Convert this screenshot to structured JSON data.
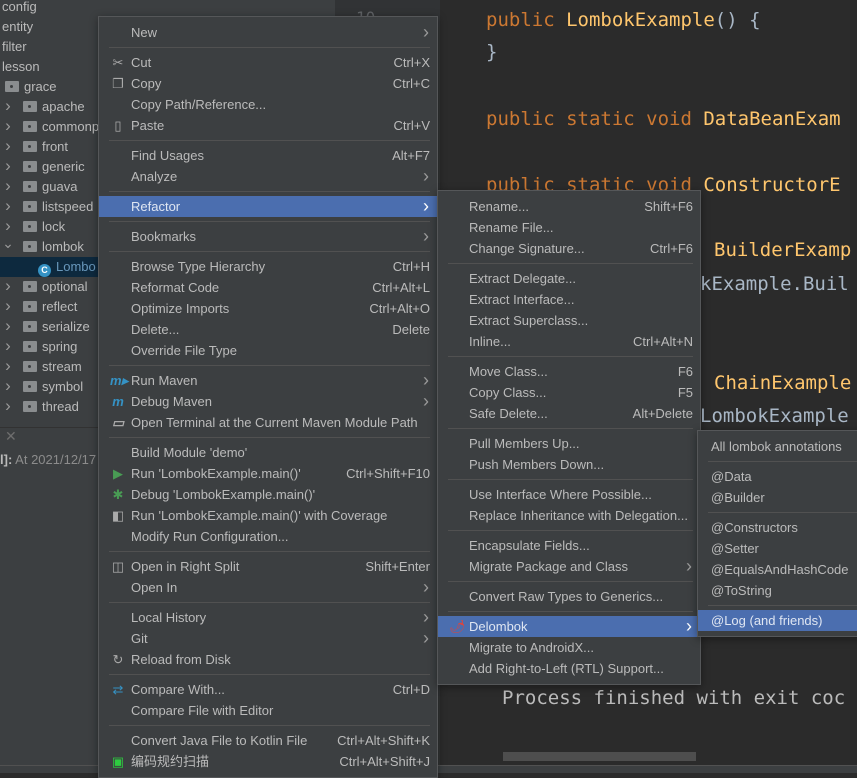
{
  "tree": {
    "items": [
      {
        "label": "config",
        "level": 0,
        "kind": "pkg"
      },
      {
        "label": "entity",
        "level": 0,
        "kind": "pkg"
      },
      {
        "label": "filter",
        "level": 0,
        "kind": "pkg"
      },
      {
        "label": "lesson",
        "level": 0,
        "kind": "pkg"
      },
      {
        "label": "grace",
        "level": 1,
        "kind": "folder"
      },
      {
        "label": "apache",
        "level": 2,
        "kind": "folder",
        "chevron": "right"
      },
      {
        "label": "commonp",
        "level": 2,
        "kind": "folder",
        "chevron": "right"
      },
      {
        "label": "front",
        "level": 2,
        "kind": "folder",
        "chevron": "right"
      },
      {
        "label": "generic",
        "level": 2,
        "kind": "folder",
        "chevron": "right"
      },
      {
        "label": "guava",
        "level": 2,
        "kind": "folder",
        "chevron": "right"
      },
      {
        "label": "listspeed",
        "level": 2,
        "kind": "folder",
        "chevron": "right"
      },
      {
        "label": "lock",
        "level": 2,
        "kind": "folder",
        "chevron": "right"
      },
      {
        "label": "lombok",
        "level": 2,
        "kind": "folder",
        "chevron": "down"
      },
      {
        "label": "Lombo",
        "level": 3,
        "kind": "class",
        "selected": true
      },
      {
        "label": "optional",
        "level": 2,
        "kind": "folder",
        "chevron": "right"
      },
      {
        "label": "reflect",
        "level": 2,
        "kind": "folder",
        "chevron": "right"
      },
      {
        "label": "serialize",
        "level": 2,
        "kind": "folder",
        "chevron": "right"
      },
      {
        "label": "spring",
        "level": 2,
        "kind": "folder",
        "chevron": "right"
      },
      {
        "label": "stream",
        "level": 2,
        "kind": "folder",
        "chevron": "right"
      },
      {
        "label": "symbol",
        "level": 2,
        "kind": "folder",
        "chevron": "right"
      },
      {
        "label": "thread",
        "level": 2,
        "kind": "folder",
        "chevron": "right"
      }
    ]
  },
  "log": {
    "prefix": "l]:",
    "text": " At 2021/12/17"
  },
  "editor": {
    "line_number": "10",
    "lines": [
      {
        "kw": "public ",
        "fn": "LombokExample",
        "rest": "() {"
      },
      {
        "kw": "",
        "fn": "",
        "rest": "}"
      },
      {
        "kw": "public static void ",
        "fn": "DataBeanExam",
        "rest": ""
      },
      {
        "kw": "public static void ",
        "fn": "ConstructorE",
        "rest": ""
      },
      {
        "kw": "",
        "fn": "BuilderExamp",
        "rest": ""
      },
      {
        "kw": "",
        "fn": "",
        "rest": "kExample.Buil"
      },
      {
        "kw": "",
        "fn": "ChainExample",
        "rest": ""
      },
      {
        "kw": "",
        "fn": "",
        "rest": "LombokExample"
      }
    ]
  },
  "console": {
    "text": "Process finished with exit coc"
  },
  "colors": {
    "menu_bg": "#3c3f41",
    "highlight": "#4b6eaf",
    "keyword": "#cc7832",
    "method": "#ffc66d",
    "text": "#a9b7c6"
  },
  "main_menu": [
    {
      "label": "New",
      "submenu": true
    },
    {
      "sep": true
    },
    {
      "label": "Cut",
      "shortcut": "Ctrl+X",
      "icon": "scissors-icon"
    },
    {
      "label": "Copy",
      "shortcut": "Ctrl+C",
      "icon": "copy-icon"
    },
    {
      "label": "Copy Path/Reference..."
    },
    {
      "label": "Paste",
      "shortcut": "Ctrl+V",
      "icon": "paste-icon"
    },
    {
      "sep": true
    },
    {
      "label": "Find Usages",
      "shortcut": "Alt+F7"
    },
    {
      "label": "Analyze",
      "submenu": true
    },
    {
      "sep": true
    },
    {
      "label": "Refactor",
      "submenu": true,
      "highlighted": true
    },
    {
      "sep": true
    },
    {
      "label": "Bookmarks",
      "submenu": true
    },
    {
      "sep": true
    },
    {
      "label": "Browse Type Hierarchy",
      "shortcut": "Ctrl+H"
    },
    {
      "label": "Reformat Code",
      "shortcut": "Ctrl+Alt+L"
    },
    {
      "label": "Optimize Imports",
      "shortcut": "Ctrl+Alt+O"
    },
    {
      "label": "Delete...",
      "shortcut": "Delete"
    },
    {
      "label": "Override File Type"
    },
    {
      "sep": true
    },
    {
      "label": "Run Maven",
      "submenu": true,
      "icon": "maven-run-icon"
    },
    {
      "label": "Debug Maven",
      "submenu": true,
      "icon": "maven-debug-icon"
    },
    {
      "label": "Open Terminal at the Current Maven Module Path",
      "icon": "maven-terminal-icon"
    },
    {
      "sep": true
    },
    {
      "label": "Build Module 'demo'"
    },
    {
      "label": "Run 'LombokExample.main()'",
      "shortcut": "Ctrl+Shift+F10",
      "icon": "run-icon"
    },
    {
      "label": "Debug 'LombokExample.main()'",
      "icon": "debug-icon"
    },
    {
      "label": "Run 'LombokExample.main()' with Coverage",
      "icon": "coverage-icon"
    },
    {
      "label": "Modify Run Configuration..."
    },
    {
      "sep": true
    },
    {
      "label": "Open in Right Split",
      "shortcut": "Shift+Enter",
      "icon": "split-icon"
    },
    {
      "label": "Open In",
      "submenu": true
    },
    {
      "sep": true
    },
    {
      "label": "Local History",
      "submenu": true
    },
    {
      "label": "Git",
      "submenu": true
    },
    {
      "label": "Reload from Disk",
      "icon": "reload-icon"
    },
    {
      "sep": true
    },
    {
      "label": "Compare With...",
      "shortcut": "Ctrl+D",
      "icon": "compare-icon"
    },
    {
      "label": "Compare File with Editor"
    },
    {
      "sep": true
    },
    {
      "label": "Convert Java File to Kotlin File",
      "shortcut": "Ctrl+Alt+Shift+K"
    },
    {
      "label": "编码规约扫描",
      "shortcut": "Ctrl+Alt+Shift+J",
      "icon": "code-scan-icon"
    }
  ],
  "refactor_menu": [
    {
      "label": "Rename...",
      "shortcut": "Shift+F6"
    },
    {
      "label": "Rename File..."
    },
    {
      "label": "Change Signature...",
      "shortcut": "Ctrl+F6"
    },
    {
      "sep": true
    },
    {
      "label": "Extract Delegate..."
    },
    {
      "label": "Extract Interface..."
    },
    {
      "label": "Extract Superclass..."
    },
    {
      "label": "Inline...",
      "shortcut": "Ctrl+Alt+N"
    },
    {
      "sep": true
    },
    {
      "label": "Move Class...",
      "shortcut": "F6"
    },
    {
      "label": "Copy Class...",
      "shortcut": "F5"
    },
    {
      "label": "Safe Delete...",
      "shortcut": "Alt+Delete"
    },
    {
      "sep": true
    },
    {
      "label": "Pull Members Up..."
    },
    {
      "label": "Push Members Down..."
    },
    {
      "sep": true
    },
    {
      "label": "Use Interface Where Possible..."
    },
    {
      "label": "Replace Inheritance with Delegation..."
    },
    {
      "sep": true
    },
    {
      "label": "Encapsulate Fields..."
    },
    {
      "label": "Migrate Package and Class",
      "submenu": true
    },
    {
      "sep": true
    },
    {
      "label": "Convert Raw Types to Generics..."
    },
    {
      "sep": true
    },
    {
      "label": "Delombok",
      "submenu": true,
      "highlighted": true,
      "icon": "chili-pepper-icon"
    },
    {
      "label": "Migrate to AndroidX..."
    },
    {
      "label": "Add Right-to-Left (RTL) Support..."
    }
  ],
  "delombok_menu": [
    {
      "label": "All lombok annotations"
    },
    {
      "sep": true
    },
    {
      "label": "@Data"
    },
    {
      "label": "@Builder"
    },
    {
      "sep": true
    },
    {
      "label": "@Constructors"
    },
    {
      "label": "@Setter"
    },
    {
      "label": "@EqualsAndHashCode"
    },
    {
      "label": "@ToString"
    },
    {
      "sep": true
    },
    {
      "label": "@Log (and friends)",
      "highlighted": true
    }
  ]
}
